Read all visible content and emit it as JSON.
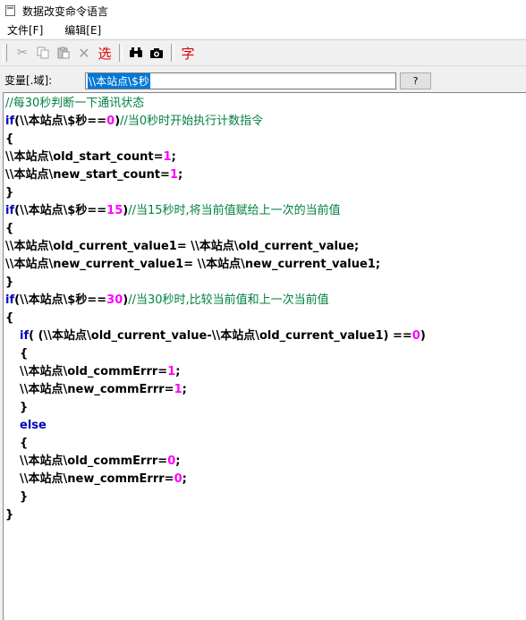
{
  "window": {
    "title": "数据改变命令语言"
  },
  "menu": {
    "file": "文件[F]",
    "edit": "编辑[E]"
  },
  "toolbar": {
    "cut_icon": "scissors-icon",
    "copy_icon": "copy-icon",
    "paste_icon": "paste-icon",
    "delete_icon": "delete-icon",
    "select_label": "选",
    "find_icon": "binoculars-icon",
    "replace_icon": "camera-icon",
    "font_label": "字"
  },
  "variable": {
    "label": "变量[.域]:",
    "value": "\\\\本站点\\$秒",
    "button": "?"
  },
  "code": {
    "l01": "//每30秒判断一下通讯状态",
    "l02a": "if",
    "l02b": "(\\\\本站点\\$秒==",
    "l02c": "0",
    "l02d": ")",
    "l02e": "//当0秒时开始执行计数指令",
    "l03": "{",
    "l04a": "\\\\本站点\\old_start_count=",
    "l04b": "1",
    "l04c": ";",
    "l05a": "\\\\本站点\\new_start_count=",
    "l05b": "1",
    "l05c": ";",
    "l06": "}",
    "l07a": "if",
    "l07b": "(\\\\本站点\\$秒==",
    "l07c": "15",
    "l07d": ")",
    "l07e": "//当15秒时,将当前值赋给上一次的当前值",
    "l08": "{",
    "l09": "\\\\本站点\\old_current_value1= \\\\本站点\\old_current_value;",
    "l10": "\\\\本站点\\new_current_value1= \\\\本站点\\new_current_value1;",
    "l11": "}",
    "l12a": "if",
    "l12b": "(\\\\本站点\\$秒==",
    "l12c": "30",
    "l12d": ")",
    "l12e": "//当30秒时,比较当前值和上一次当前值",
    "l13": "{",
    "l14a": "if",
    "l14b": "( (\\\\本站点\\old_current_value-\\\\本站点\\old_current_value1) ==",
    "l14c": "0",
    "l14d": ")",
    "l15": "{",
    "l16a": "\\\\本站点\\old_commErrr=",
    "l16b": "1",
    "l16c": ";",
    "l17a": "\\\\本站点\\new_commErrr=",
    "l17b": "1",
    "l17c": ";",
    "l18": "}",
    "l19": "else",
    "l20": "{",
    "l21a": "\\\\本站点\\old_commErrr=",
    "l21b": "0",
    "l21c": ";",
    "l22a": "\\\\本站点\\new_commErrr=",
    "l22b": "0",
    "l22c": ";",
    "l23": "}",
    "l24": "}"
  }
}
